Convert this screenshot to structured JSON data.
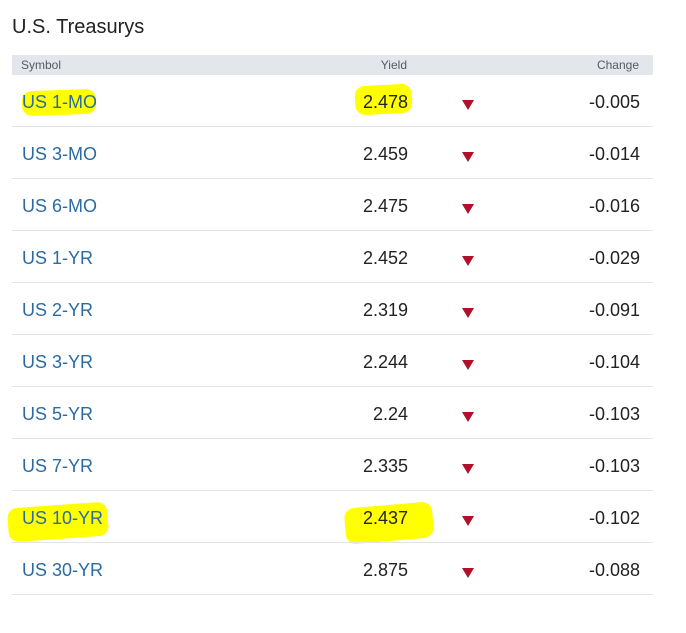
{
  "title": "U.S. Treasurys",
  "header": {
    "symbol": "Symbol",
    "yield": "Yield",
    "change": "Change"
  },
  "accent_colors": {
    "link": "#2a6ba3",
    "down_arrow": "#b0102a",
    "highlight": "#ffff00"
  },
  "rows": [
    {
      "symbol": "US 1-MO",
      "yield": "2.478",
      "change": "-0.005",
      "direction": "down-arrow-icon",
      "highlighted": true
    },
    {
      "symbol": "US 3-MO",
      "yield": "2.459",
      "change": "-0.014",
      "direction": "down-arrow-icon",
      "highlighted": false
    },
    {
      "symbol": "US 6-MO",
      "yield": "2.475",
      "change": "-0.016",
      "direction": "down-arrow-icon",
      "highlighted": false
    },
    {
      "symbol": "US 1-YR",
      "yield": "2.452",
      "change": "-0.029",
      "direction": "down-arrow-icon",
      "highlighted": false
    },
    {
      "symbol": "US 2-YR",
      "yield": "2.319",
      "change": "-0.091",
      "direction": "down-arrow-icon",
      "highlighted": false
    },
    {
      "symbol": "US 3-YR",
      "yield": "2.244",
      "change": "-0.104",
      "direction": "down-arrow-icon",
      "highlighted": false
    },
    {
      "symbol": "US 5-YR",
      "yield": "2.24",
      "change": "-0.103",
      "direction": "down-arrow-icon",
      "highlighted": false
    },
    {
      "symbol": "US 7-YR",
      "yield": "2.335",
      "change": "-0.103",
      "direction": "down-arrow-icon",
      "highlighted": false
    },
    {
      "symbol": "US 10-YR",
      "yield": "2.437",
      "change": "-0.102",
      "direction": "down-arrow-icon",
      "highlighted": true
    },
    {
      "symbol": "US 30-YR",
      "yield": "2.875",
      "change": "-0.088",
      "direction": "down-arrow-icon",
      "highlighted": false
    }
  ]
}
